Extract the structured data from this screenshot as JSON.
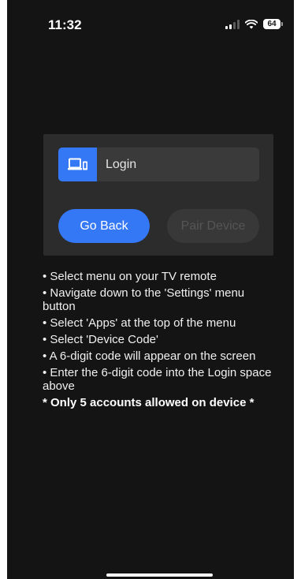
{
  "status_bar": {
    "time": "11:32",
    "battery": "64"
  },
  "login": {
    "icon": "tv-device-icon",
    "label": "Login"
  },
  "buttons": {
    "go_back": "Go Back",
    "pair_device": "Pair Device"
  },
  "instructions": {
    "steps": [
      "• Select menu on your TV remote",
      "• Navigate down to the 'Settings' menu button",
      "• Select 'Apps' at the top of the menu",
      "• Select 'Device Code'",
      "• A 6-digit code will appear on the screen",
      "• Enter the 6-digit code into the Login space above"
    ],
    "note": "* Only 5 accounts allowed on device *"
  },
  "colors": {
    "background": "#141414",
    "card": "#2c2c2c",
    "accent": "#3578f6",
    "disabled_button": "#383838"
  }
}
